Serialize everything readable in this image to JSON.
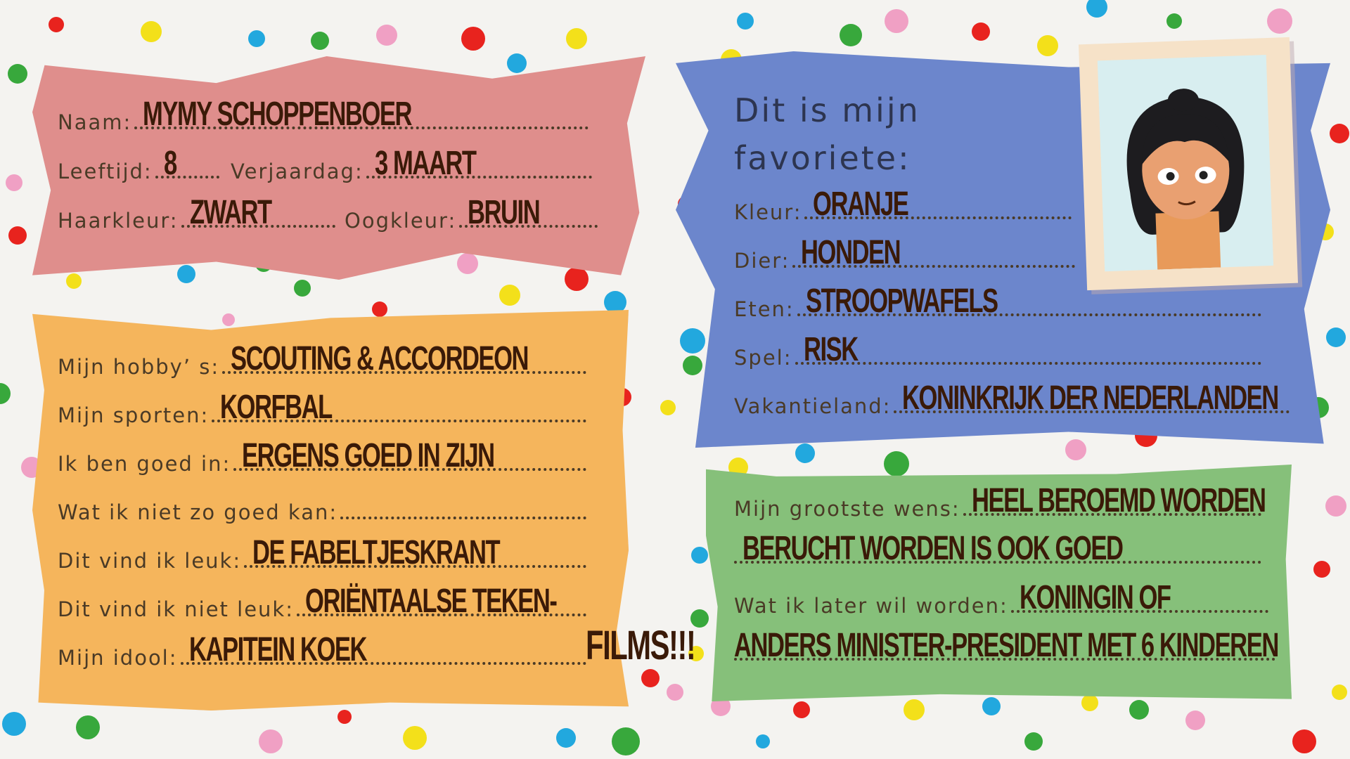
{
  "colors": {
    "pink": "#df8e8c",
    "orange": "#f5b55c",
    "blue": "#6c86cc",
    "green": "#86c07a",
    "ink": "#3a1a08"
  },
  "personal": {
    "name_label": "Naam:",
    "name": "MYMY SCHOPPENBOER",
    "age_label": "Leeftijd:",
    "age": "8",
    "birthday_label": "Verjaardag:",
    "birthday": "3 MAART",
    "hair_label": "Haarkleur:",
    "hair": "ZWART",
    "eye_label": "Oogkleur:",
    "eye": "BRUIN"
  },
  "hobbies": {
    "rows": [
      {
        "label": "Mijn hobby’ s:",
        "value": "SCOUTING & ACCORDEON"
      },
      {
        "label": "Mijn sporten:",
        "value": "KORFBAL"
      },
      {
        "label": "Ik ben goed in:",
        "value": "ERGENS GOED IN ZIJN"
      },
      {
        "label": "Wat ik niet zo goed kan:",
        "value": ""
      },
      {
        "label": "Dit vind ik leuk:",
        "value": "DE FABELTJESKRANT"
      },
      {
        "label": "Dit vind ik niet leuk:",
        "value": "ORIËNTAALSE TEKEN-"
      },
      {
        "label": "Mijn idool:",
        "value": "KAPITEIN KOEK",
        "extra": "FILMS!!!"
      }
    ]
  },
  "favorites": {
    "title_line1": "Dit is mijn",
    "title_line2": "favoriete:",
    "rows": [
      {
        "label": "Kleur:",
        "value": "ORANJE"
      },
      {
        "label": "Dier:",
        "value": "HONDEN"
      },
      {
        "label": "Eten:",
        "value": "STROOPWAFELS"
      },
      {
        "label": "Spel:",
        "value": "RISK"
      },
      {
        "label": "Vakantieland:",
        "value": "KONINKRIJK DER NEDERLANDEN"
      }
    ]
  },
  "wishes": {
    "wish_label": "Mijn grootste wens:",
    "wish_line1": "HEEL BEROEMD WORDEN",
    "wish_line2": "BERUCHT WORDEN IS OOK GOED",
    "career_label": "Wat ik later wil worden:",
    "career_line1": "KONINGIN OF",
    "career_line2": "ANDERS MINISTER-PRESIDENT MET 6 KINDEREN"
  },
  "portrait": {
    "icon": "girl-portrait"
  }
}
